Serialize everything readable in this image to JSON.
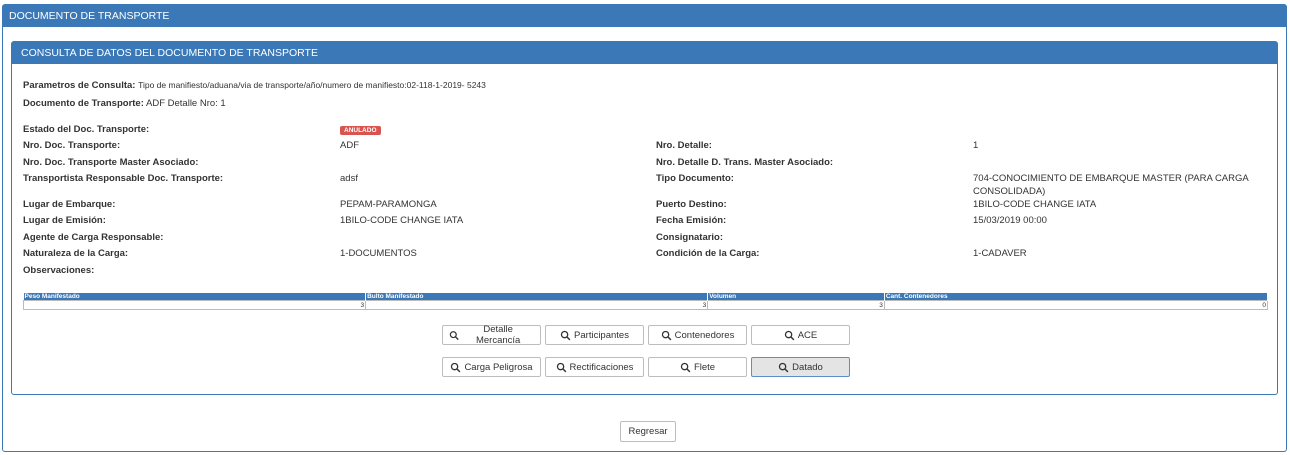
{
  "page_title": "DOCUMENTO DE TRANSPORTE",
  "panel_title": "CONSULTA DE DATOS DEL DOCUMENTO DE TRANSPORTE",
  "params": {
    "consulta_label": "Parametros de Consulta:",
    "consulta_value": "Tipo de manifiesto/aduana/via de transporte/año/numero de manifiesto:02-118-1-2019- 5243",
    "doc_label": "Documento de Transporte:",
    "doc_value": "ADF Detalle Nro: 1"
  },
  "fields": {
    "estado_label": "Estado del Doc. Transporte:",
    "estado_value": "ANULADO",
    "nro_doc_label": "Nro. Doc. Transporte:",
    "nro_doc_value": "ADF",
    "nro_detalle_label": "Nro. Detalle:",
    "nro_detalle_value": "1",
    "master_label": "Nro. Doc. Transporte Master Asociado:",
    "master_value": "",
    "detalle_master_label": "Nro. Detalle D. Trans. Master Asociado:",
    "detalle_master_value": "",
    "transportista_label": "Transportista Responsable Doc. Transporte:",
    "transportista_value": "adsf",
    "tipo_doc_label": "Tipo Documento:",
    "tipo_doc_value_1": "704-CONOCIMIENTO DE EMBARQUE MASTER (PARA CARGA",
    "tipo_doc_value_2": "CONSOLIDADA)",
    "embarque_label": "Lugar de Embarque:",
    "embarque_value": "PEPAM-PARAMONGA",
    "destino_label": "Puerto Destino:",
    "destino_value": "1BILO-CODE CHANGE IATA",
    "emision_label": "Lugar de Emisión:",
    "emision_value": "1BILO-CODE CHANGE IATA",
    "fecha_label": "Fecha Emisión:",
    "fecha_value": "15/03/2019 00:00",
    "agente_label": "Agente de Carga Responsable:",
    "agente_value": "",
    "consignatario_label": "Consignatario:",
    "consignatario_value": "",
    "naturaleza_label": "Naturaleza de la Carga:",
    "naturaleza_value": "1-DOCUMENTOS",
    "condicion_label": "Condición de la Carga:",
    "condicion_value": "1-CADAVER",
    "observaciones_label": "Observaciones:",
    "observaciones_value": ""
  },
  "summary": {
    "headers": [
      "Peso Manifestado",
      "Bulto Manifestado",
      "Volumen",
      "Cant. Contenedores"
    ],
    "values": [
      "3",
      "3",
      "3",
      "0"
    ]
  },
  "buttons": {
    "detalle_mercancia": "Detalle Mercancía",
    "participantes": "Participantes",
    "contenedores": "Contenedores",
    "ace": "ACE",
    "carga_peligrosa": "Carga Peligrosa",
    "rectificaciones": "Rectificaciones",
    "flete": "Flete",
    "datado": "Datado",
    "regresar": "Regresar"
  },
  "colors": {
    "header_blue": "#3a78b8",
    "badge_red": "#d9534f"
  },
  "icons": {
    "button_icon": "magnifier-icon"
  }
}
